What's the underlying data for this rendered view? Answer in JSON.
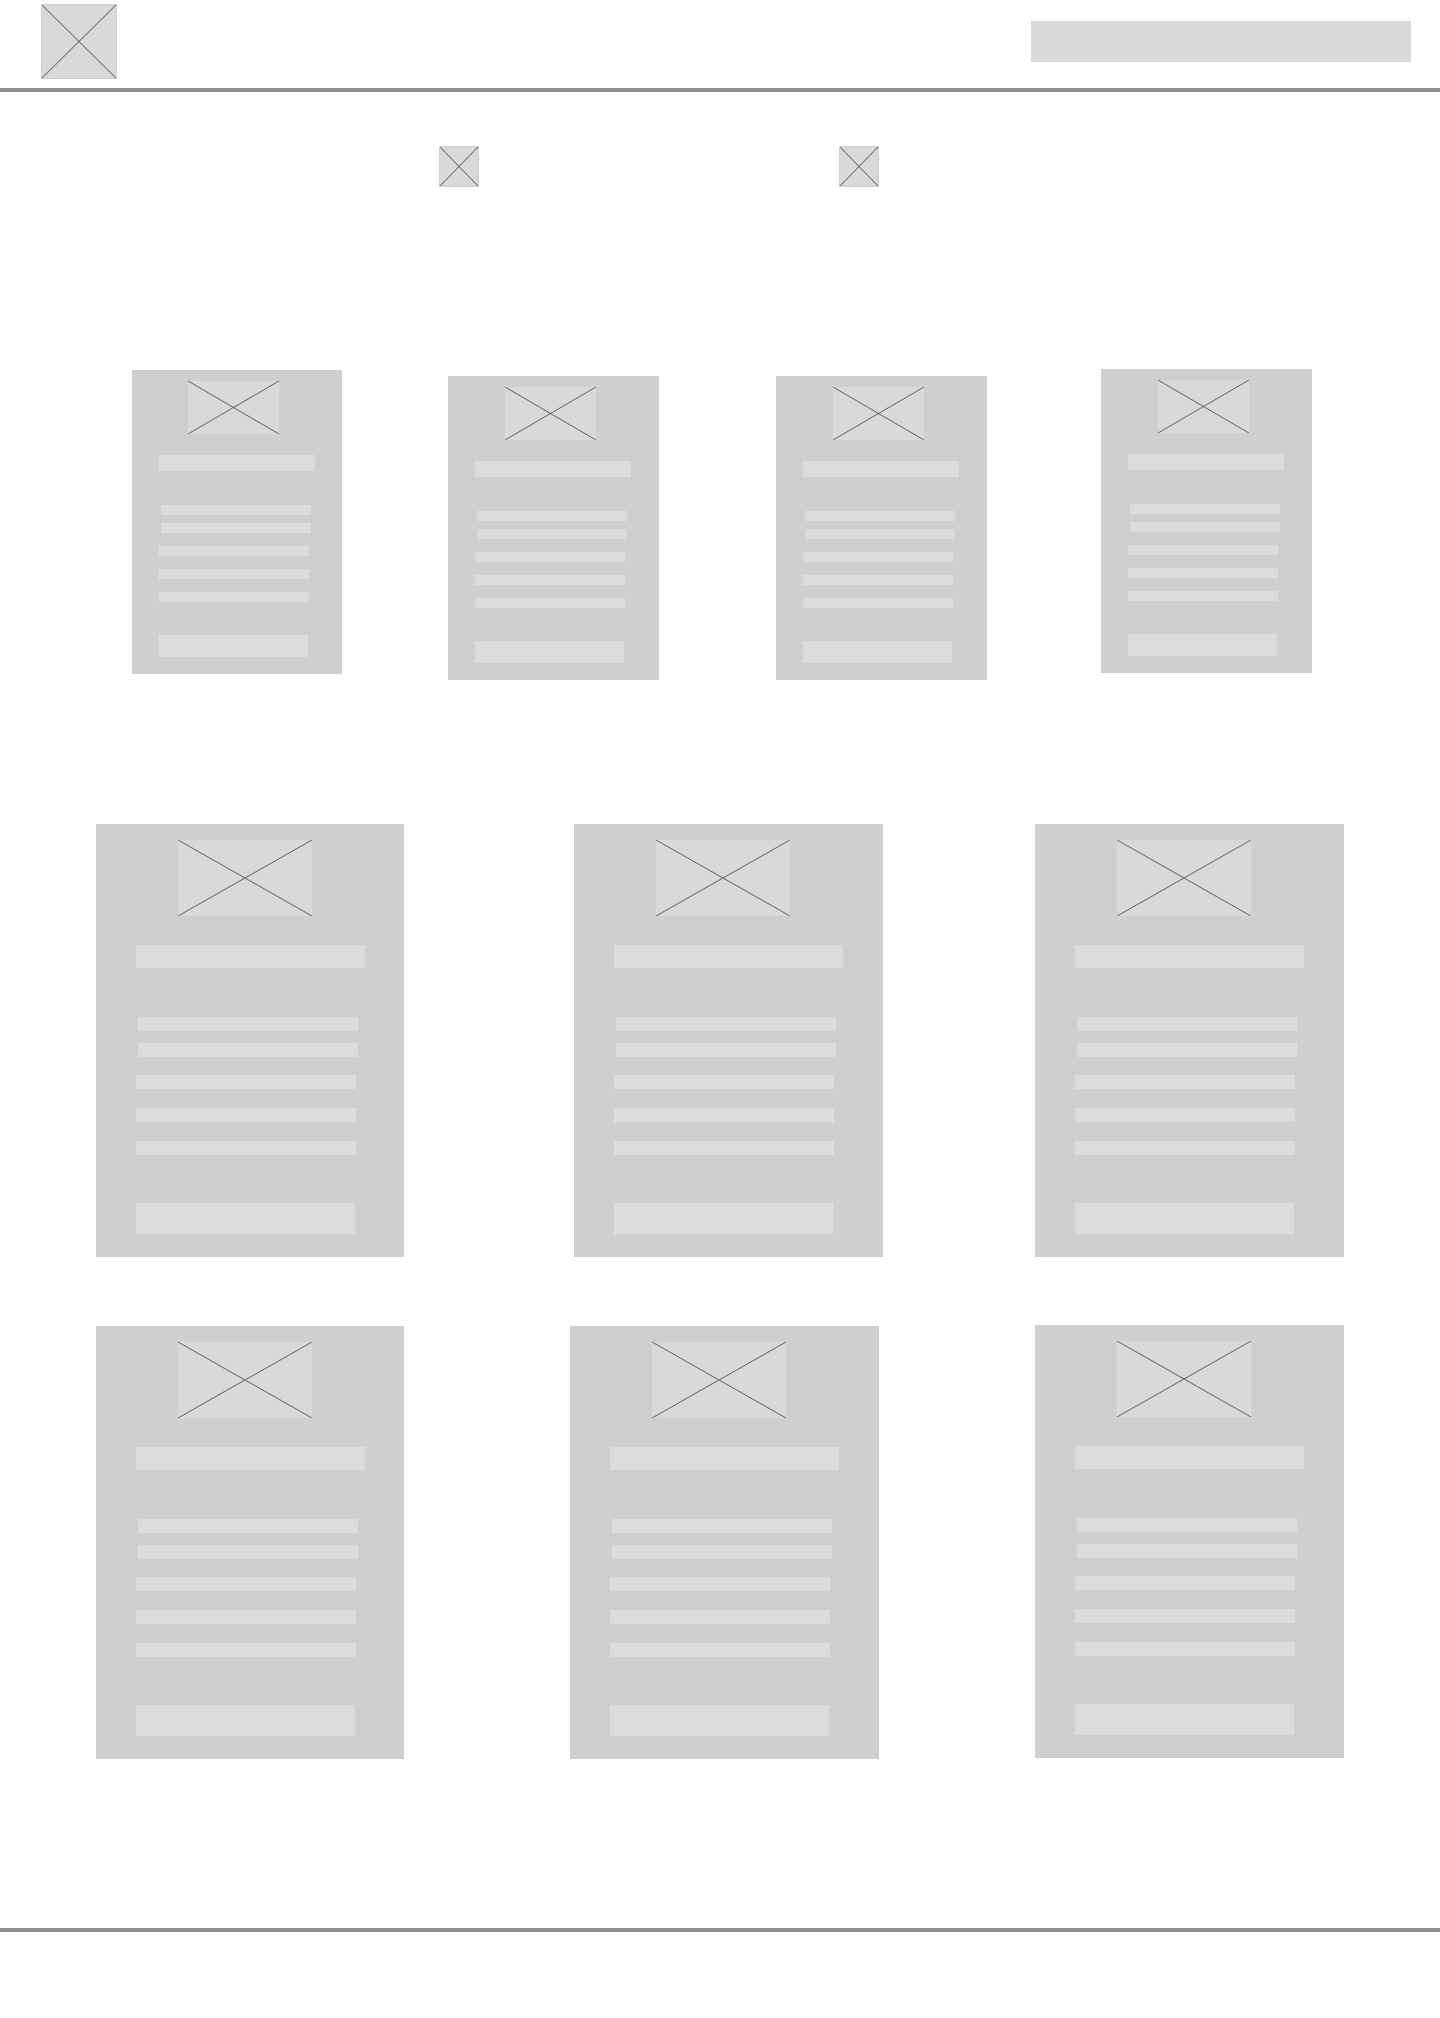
{
  "header": {
    "logo_icon": "image-placeholder-icon",
    "search_bar": "search-input-placeholder"
  },
  "nav": {
    "icons": [
      "image-placeholder-icon",
      "image-placeholder-icon"
    ]
  },
  "row1": {
    "cards": [
      {
        "image": "image-placeholder-icon"
      },
      {
        "image": "image-placeholder-icon"
      },
      {
        "image": "image-placeholder-icon"
      },
      {
        "image": "image-placeholder-icon"
      }
    ]
  },
  "row2": {
    "cards": [
      {
        "image": "image-placeholder-icon"
      },
      {
        "image": "image-placeholder-icon"
      },
      {
        "image": "image-placeholder-icon"
      }
    ]
  },
  "row3": {
    "cards": [
      {
        "image": "image-placeholder-icon"
      },
      {
        "image": "image-placeholder-icon"
      },
      {
        "image": "image-placeholder-icon"
      }
    ]
  },
  "colors": {
    "page_background": "#ffffff",
    "card_fill": "#cfcfcf",
    "placeholder_fill": "#dcdcdc",
    "rule": "#8f8f8f"
  }
}
